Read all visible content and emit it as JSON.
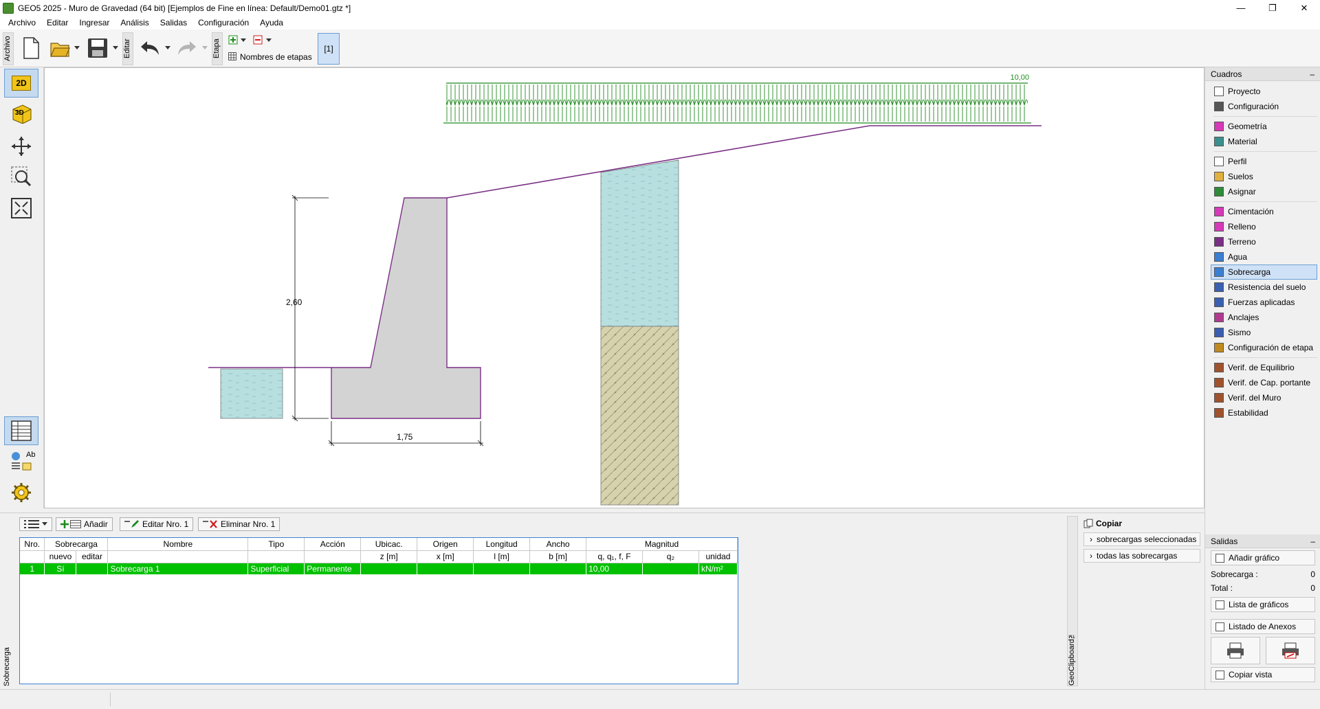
{
  "window": {
    "title": "GEO5 2025 - Muro de Gravedad (64 bit) [Ejemplos de Fine en línea: Default/Demo01.gtz *]",
    "minimize": "—",
    "restore": "❐",
    "close": "✕"
  },
  "menu": [
    "Archivo",
    "Editar",
    "Ingresar",
    "Análisis",
    "Salidas",
    "Configuración",
    "Ayuda"
  ],
  "toolbar": {
    "archivo_label": "Archivo",
    "editar_label": "Editar",
    "etapa_label": "Etapa",
    "stage_names": "Nombres de etapas",
    "stage_current": "[1]"
  },
  "left_tools": {
    "btn_2d": "2D",
    "btn_3d": "3D",
    "legend_text": "Ab"
  },
  "drawing": {
    "surcharge_value": "10,00",
    "height_dim": "2,60",
    "width_dim": "1,75"
  },
  "right_panel": {
    "header": "Cuadros",
    "collapse": "–",
    "groups": [
      [
        {
          "label": "Proyecto",
          "icon": "document-icon"
        },
        {
          "label": "Configuración",
          "icon": "gear-icon"
        }
      ],
      [
        {
          "label": "Geometría",
          "icon": "geometry-icon"
        },
        {
          "label": "Material",
          "icon": "material-icon"
        }
      ],
      [
        {
          "label": "Perfil",
          "icon": "profile-icon"
        },
        {
          "label": "Suelos",
          "icon": "soils-icon"
        },
        {
          "label": "Asignar",
          "icon": "assign-icon"
        }
      ],
      [
        {
          "label": "Cimentación",
          "icon": "foundation-icon"
        },
        {
          "label": "Relleno",
          "icon": "backfill-icon"
        },
        {
          "label": "Terreno",
          "icon": "terrain-icon"
        },
        {
          "label": "Agua",
          "icon": "water-icon"
        },
        {
          "label": "Sobrecarga",
          "icon": "surcharge-icon"
        },
        {
          "label": "Resistencia del suelo",
          "icon": "resistance-icon"
        },
        {
          "label": "Fuerzas aplicadas",
          "icon": "forces-icon"
        },
        {
          "label": "Anclajes",
          "icon": "anchor-icon"
        },
        {
          "label": "Sismo",
          "icon": "earthquake-icon"
        },
        {
          "label": "Configuración de etapa",
          "icon": "stage-settings-icon"
        }
      ],
      [
        {
          "label": "Verif. de Equilibrio",
          "icon": "equilibrium-icon"
        },
        {
          "label": "Verif. de Cap. portante",
          "icon": "bearing-icon"
        },
        {
          "label": "Verif. del Muro",
          "icon": "wall-check-icon"
        },
        {
          "label": "Estabilidad",
          "icon": "stability-icon"
        }
      ]
    ],
    "active": "Sobrecarga",
    "outputs": {
      "header": "Salidas",
      "add_graphic": "Añadir gráfico",
      "surcharge_label": "Sobrecarga :",
      "surcharge_count": "0",
      "total_label": "Total :",
      "total_count": "0",
      "graphics_list": "Lista de gráficos",
      "annex_list": "Listado de Anexos",
      "copy_view": "Copiar vista"
    }
  },
  "bottom": {
    "side_label": "Sobrecarga",
    "add": "Añadir",
    "edit": "Editar Nro. 1",
    "delete": "Eliminar Nro. 1",
    "table": {
      "h1": [
        "Nro.",
        "Sobrecarga",
        "Nombre",
        "Tipo",
        "Acción",
        "Ubicac.",
        "Origen",
        "Longitud",
        "Ancho",
        "Magnitud"
      ],
      "h2": [
        "nuevo",
        "editar",
        "z [m]",
        "x [m]",
        "l [m]",
        "b [m]",
        "q, q₁, f, F",
        "q₂",
        "unidad"
      ],
      "rows": [
        [
          "1",
          "Sí",
          "",
          "Sobrecarga 1",
          "Superficial",
          "Permanente",
          "",
          "",
          "",
          "",
          "10,00",
          "",
          "kN/m²"
        ]
      ]
    },
    "clipboard": {
      "side_label": "GeoClipboard™",
      "copy": "Copiar",
      "selected": "sobrecargas seleccionadas",
      "all": "todas las sobrecargas"
    }
  },
  "colors": {
    "selected_row": "#00c000",
    "surcharge": "#1f8a1f",
    "terrain": "#7a2f85",
    "water": "#b7dfe0",
    "soil": "#d6d2ad",
    "wall": "#d3d3d3"
  }
}
